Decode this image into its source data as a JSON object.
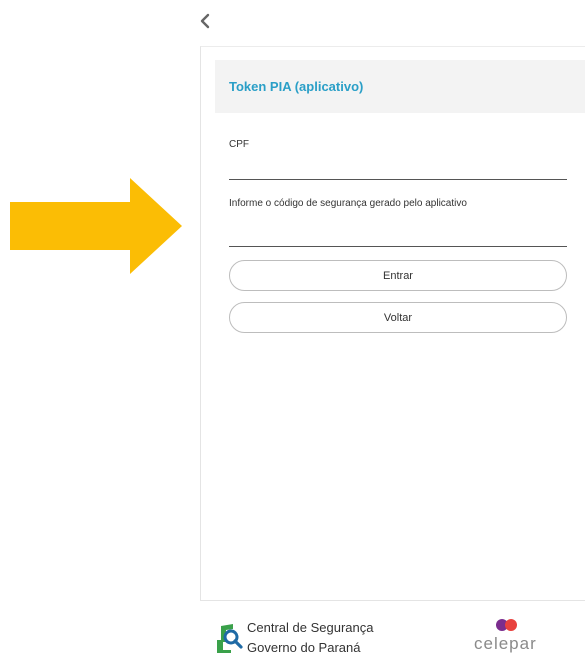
{
  "navigation": {
    "back_icon": "chevron-left-icon"
  },
  "annotation": {
    "arrow_icon": "arrow-right-icon",
    "arrow_color": "#fbbd05"
  },
  "panel": {
    "title": "Token PIA (aplicativo)",
    "title_color": "#2a9fc7",
    "header_bg": "#f3f3f3"
  },
  "form": {
    "cpf": {
      "label": "CPF",
      "value": ""
    },
    "security_code": {
      "label": "Informe o código de segurança gerado pelo aplicativo",
      "value": ""
    }
  },
  "buttons": {
    "submit_label": "Entrar",
    "back_label": "Voltar"
  },
  "footer": {
    "logo_icon": "magnifier-shield-logo-icon",
    "org_line1": "Central de Segurança",
    "org_line2": "Governo do Paraná",
    "brand_dots_icon": "celepar-dots-icon",
    "brand_name": "celepar",
    "brand_colors": [
      "#7b2d8e",
      "#e8413e"
    ]
  }
}
